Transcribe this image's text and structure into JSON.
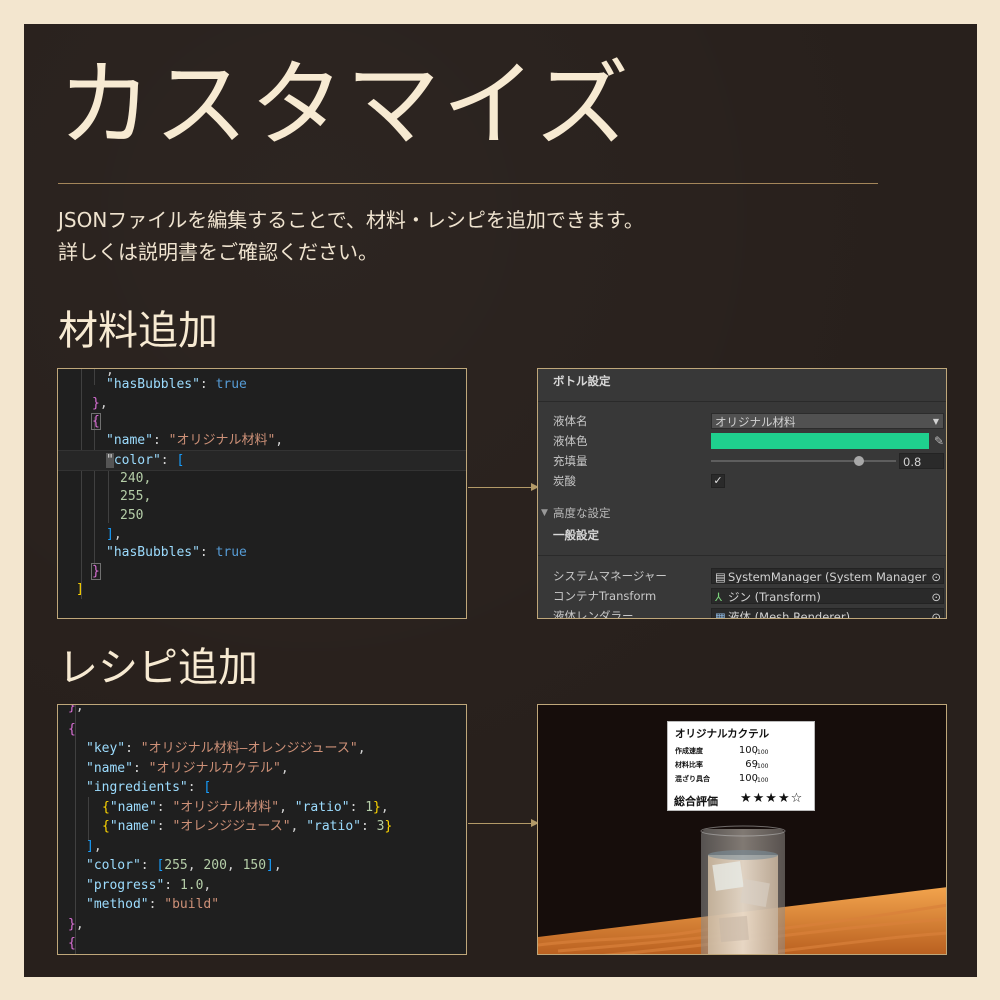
{
  "title": "カスタマイズ",
  "description": {
    "line1": "JSONファイルを編集することで、材料・レシピを追加できます。",
    "line2": "詳しくは説明書をご確認ください。"
  },
  "sections": {
    "ingredient_title": "材料追加",
    "recipe_title": "レシピ追加"
  },
  "ingredient_code": {
    "key_hasBubbles": "\"hasBubbles\"",
    "val_true": "true",
    "key_name": "\"name\"",
    "val_name": "\"オリジナル材料\"",
    "key_color": "color\"",
    "color_values": [
      "240,",
      "255,",
      "250"
    ]
  },
  "inspector": {
    "bottle_settings": "ボトル設定",
    "liquid_name_label": "液体名",
    "liquid_name_value": "オリジナル材料",
    "liquid_color_label": "液体色",
    "liquid_color": "#1fd08e",
    "fill_label": "充填量",
    "fill_value": "0.8",
    "fill_fraction": 0.8,
    "carbonated_label": "炭酸",
    "carbonated_checked": "✓",
    "advanced_label": "高度な設定",
    "general_label": "一般設定",
    "system_manager_label": "システムマネージャー",
    "system_manager_value": "SystemManager (System Manager",
    "container_label": "コンテナTransform",
    "container_value": "ジン (Transform)",
    "renderer_label": "液体レンダラー",
    "renderer_value": "液体 (Mesh Renderer)"
  },
  "recipe_code": {
    "key_key": "\"key\"",
    "val_key": "\"オリジナル材料—オレンジジュース\"",
    "key_name": "\"name\"",
    "val_name": "\"オリジナルカクテル\"",
    "key_ingredients": "\"ingredients\"",
    "ing1_name": "\"オリジナル材料\"",
    "ing1_ratio": "1",
    "ing2_name": "\"オレンジジュース\"",
    "ing2_ratio": "3",
    "key_color": "\"color\"",
    "color_values": [
      "255",
      "200",
      "150"
    ],
    "key_progress": "\"progress\"",
    "val_progress": "1.0",
    "key_method": "\"method\"",
    "val_method": "\"build\"",
    "key_ratio": "\"ratio\""
  },
  "game_card": {
    "title": "オリジナルカクテル",
    "rows": [
      {
        "label": "作成速度",
        "value": "100",
        "max": "/100"
      },
      {
        "label": "材料比率",
        "value": "69",
        "max": "/100"
      },
      {
        "label": "混ざり具合",
        "value": "100",
        "max": "/100"
      }
    ],
    "overall_label": "総合評価",
    "stars": "★★★★☆",
    "rating": 4
  }
}
